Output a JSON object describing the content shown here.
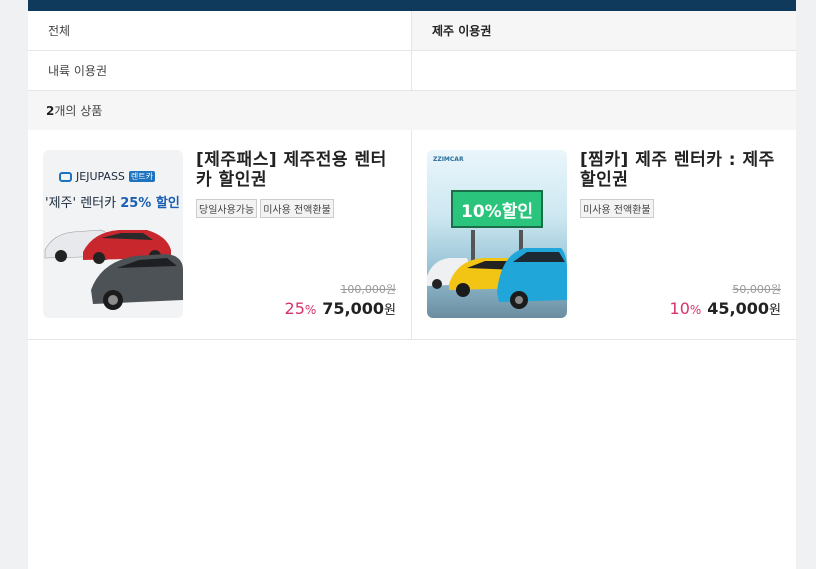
{
  "tabs": {
    "all_label": "전체",
    "jeju_label": "제주 이용권",
    "history_label": "내륙 이용권"
  },
  "count": {
    "number": "2",
    "suffix": "개의 상품"
  },
  "products": [
    {
      "title": "[제주패스] 제주전용 렌터카 할인권",
      "tags": [
        "당일사용가능",
        "미사용 전액환불"
      ],
      "original_price": "100,000원",
      "discount_rate": "25",
      "percent_sign": "%",
      "price": "75,000",
      "currency": "원",
      "thumb": {
        "brand": "JEJUPASS",
        "brand_tag": "렌트카",
        "promo_prefix": "'제주' 렌터카 ",
        "promo_highlight": "25% 할인"
      }
    },
    {
      "title": "[찜카] 제주 렌터카 : 제주 할인권",
      "tags": [
        "미사용 전액환불"
      ],
      "original_price": "50,000원",
      "discount_rate": "10",
      "percent_sign": "%",
      "price": "45,000",
      "currency": "원",
      "thumb": {
        "brand": "ZZIMCAR",
        "billboard": "10%할인"
      }
    }
  ],
  "colors": {
    "topbar": "#0f3a5c",
    "discount": "#d6336c"
  }
}
